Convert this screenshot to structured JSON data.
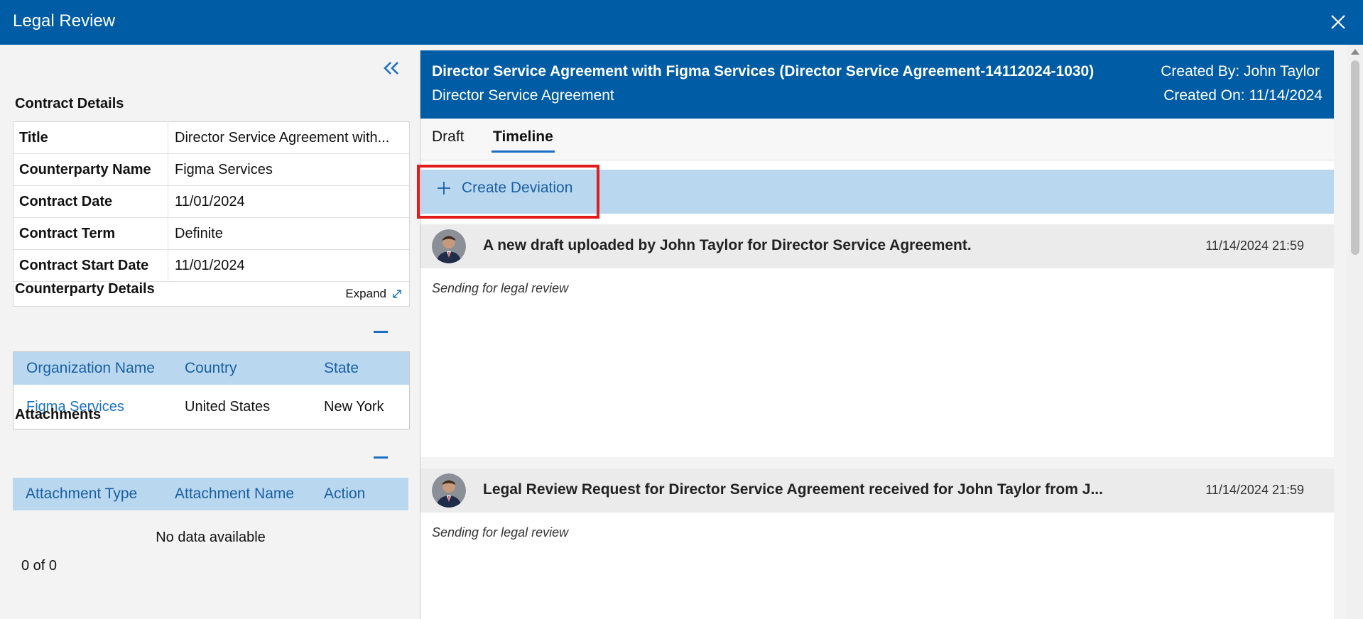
{
  "window": {
    "title": "Legal Review"
  },
  "contract_details": {
    "heading": "Contract Details",
    "rows": [
      {
        "label": "Title",
        "value": "Director Service Agreement with..."
      },
      {
        "label": "Counterparty Name",
        "value": "Figma Services"
      },
      {
        "label": "Contract Date",
        "value": "11/01/2024"
      },
      {
        "label": "Contract Term",
        "value": "Definite"
      },
      {
        "label": "Contract Start Date",
        "value": "11/01/2024"
      }
    ],
    "expand_label": "Expand"
  },
  "counterparty_details": {
    "heading": "Counterparty Details",
    "columns": [
      "Organization Name",
      "Country",
      "State"
    ],
    "rows": [
      {
        "organization": "Figma Services",
        "country": "United States",
        "state": "New York"
      }
    ]
  },
  "attachments": {
    "heading": "Attachments",
    "columns": [
      "Attachment Type",
      "Attachment Name",
      "Action"
    ],
    "empty_text": "No data available",
    "pager": "0 of 0"
  },
  "contract_header": {
    "title": "Director Service Agreement with Figma Services (Director Service Agreement-14112024-1030)",
    "subtitle": "Director Service Agreement",
    "created_by": "Created By: John Taylor",
    "created_on": "Created On: 11/14/2024"
  },
  "tabs": [
    {
      "label": "Draft",
      "active": false
    },
    {
      "label": "Timeline",
      "active": true
    }
  ],
  "create_deviation_label": "Create Deviation",
  "timeline": [
    {
      "message": "A new draft uploaded by John Taylor for Director Service Agreement.",
      "timestamp": "11/14/2024 21:59",
      "note": "Sending for legal review"
    },
    {
      "message": "Legal Review Request for Director Service Agreement received for John Taylor from J...",
      "timestamp": "11/14/2024 21:59",
      "note": "Sending for legal review"
    }
  ],
  "colors": {
    "brand": "#005ca5",
    "header_light": "#b9d8f0",
    "link": "#1a6fc4",
    "highlight": "#e31b1b"
  },
  "icons": [
    "close-icon",
    "double-chevron-left-icon",
    "expand-icon",
    "minus-icon",
    "plus-icon",
    "avatar-icon"
  ]
}
